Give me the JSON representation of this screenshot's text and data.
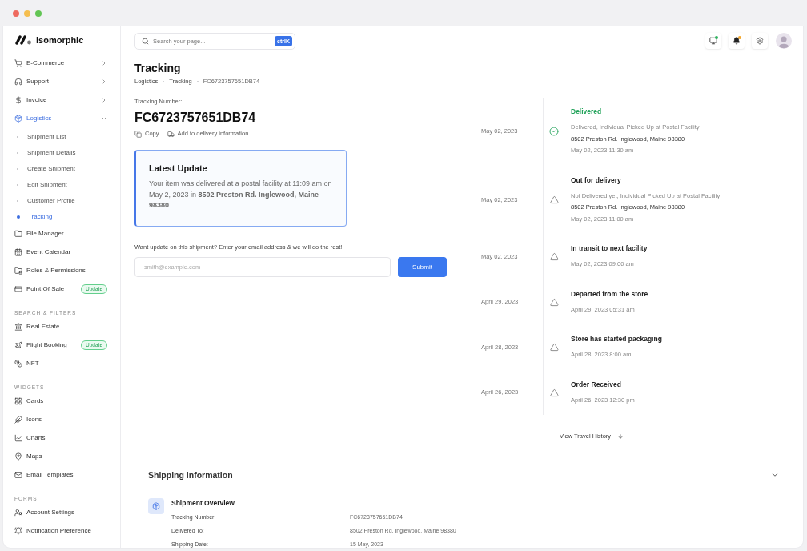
{
  "sidebar": {
    "logo": "isomorphic",
    "sections": [
      {
        "items": [
          {
            "label": "E-Commerce",
            "selected": false,
            "expanded": false
          },
          {
            "label": "Support",
            "selected": false,
            "expanded": false
          },
          {
            "label": "Invoice",
            "selected": false,
            "expanded": false
          },
          {
            "label": "Logistics",
            "selected": true,
            "expanded": true,
            "children": [
              {
                "label": "Shipment List",
                "selected": false
              },
              {
                "label": "Shipment Details",
                "selected": false
              },
              {
                "label": "Create Shipment",
                "selected": false
              },
              {
                "label": "Edit Shipment",
                "selected": false
              },
              {
                "label": "Customer Profile",
                "selected": false
              },
              {
                "label": "Tracking",
                "selected": true
              }
            ]
          },
          {
            "label": "File Manager",
            "selected": false
          },
          {
            "label": "Event Calendar",
            "selected": false
          },
          {
            "label": "Roles & Permissions",
            "selected": false
          },
          {
            "label": "Point Of Sale",
            "selected": false,
            "badge": "Update"
          }
        ]
      },
      {
        "title": "SEARCH & FILTERS",
        "items": [
          {
            "label": "Real Estate",
            "selected": false
          },
          {
            "label": "Flight Booking",
            "selected": false,
            "badge": "Update"
          },
          {
            "label": "NFT",
            "selected": false
          }
        ]
      },
      {
        "title": "WIDGETS",
        "items": [
          {
            "label": "Cards",
            "selected": false
          },
          {
            "label": "Icons",
            "selected": false
          },
          {
            "label": "Charts",
            "selected": false
          },
          {
            "label": "Maps",
            "selected": false
          },
          {
            "label": "Email Templates",
            "selected": false
          }
        ]
      },
      {
        "title": "FORMS",
        "items": [
          {
            "label": "Account Settings",
            "selected": false
          },
          {
            "label": "Notification Preference",
            "selected": false
          }
        ]
      }
    ]
  },
  "header": {
    "search": {
      "placeholder": "Search your page...",
      "shortcut": "ctrlK"
    }
  },
  "page": {
    "title": "Tracking",
    "breadcrumb": [
      "Logistics",
      "Tracking",
      "FC6723757651DB74"
    ]
  },
  "tracking": {
    "label": "Tracking Number:",
    "number": "FC6723757651DB74",
    "actions": [
      "Copy",
      "Add to delivery information"
    ]
  },
  "latest_update": {
    "title": "Latest Update",
    "text": "Your item was delivered at a postal facility at 11:09 am on May 2, 2023 in **8502 Preston Rd. Inglewood, Maine 98380**"
  },
  "subscribe": {
    "prompt": "Want update on this shipment? Enter your email address & we will do the rest!",
    "placeholder": "smith@example.com",
    "button": "Submit"
  },
  "timeline": {
    "events": [
      {
        "date": "May 02, 2023",
        "title": "Delivered",
        "completed": true,
        "description": "Delivered, Individual Picked Up at Postal Facility",
        "address": "8502 Preston Rd. Inglewood, Maine 98380",
        "time": "May 02, 2023 11:30 am"
      },
      {
        "date": "May 02, 2023",
        "title": "Out for delivery",
        "completed": false,
        "description": "Not Delivered yet, Individual Picked Up at Postal Facility",
        "address": "8502 Preston Rd. Inglewood, Maine 98380",
        "time": "May 02, 2023 11:00 am"
      },
      {
        "date": "May 02, 2023",
        "title": "In transit to next facility",
        "completed": false,
        "time": "May 02, 2023 09:00 am"
      },
      {
        "date": "April 29, 2023",
        "title": "Departed from the store",
        "completed": false,
        "time": "April 29, 2023 05:31 am"
      },
      {
        "date": "April 28, 2023",
        "title": "Store has started packaging",
        "completed": false,
        "time": "April 28, 2023 8:00 am"
      },
      {
        "date": "April 26, 2023",
        "title": "Order Received",
        "completed": false,
        "time": "April 26, 2023 12:30 pm"
      }
    ],
    "view_history": "View Travel History"
  },
  "shipping_information": {
    "title": "Shipping Information",
    "overview": {
      "title": "Shipment Overview",
      "rows": [
        {
          "label": "Tracking Number:",
          "value": "FC6723757651DB74"
        },
        {
          "label": "Delivered To:",
          "value": "8502 Preston Rd. Inglewood, Maine 98380"
        },
        {
          "label": "Shipping Date:",
          "value": "15 May, 2023"
        }
      ]
    }
  }
}
